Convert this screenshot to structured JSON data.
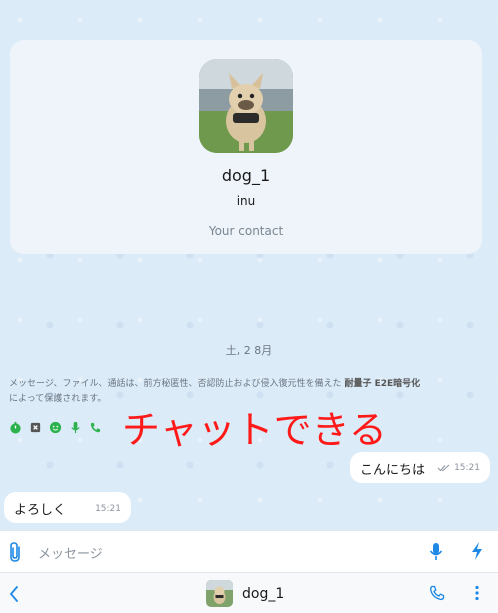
{
  "contact": {
    "name": "dog_1",
    "subtitle": "inu",
    "note": "Your contact"
  },
  "chat": {
    "date_separator": "土, 2 8月",
    "e2e_notice_prefix": "メッセージ、ファイル、通話は、前方秘匿性、否認防止および侵入復元性を備えた",
    "e2e_notice_bold": "耐量子 E2E暗号化",
    "e2e_notice_suffix": "によって保護されます。",
    "overlay_caption": "チャットできる",
    "messages": [
      {
        "direction": "outgoing",
        "text": "こんにちは",
        "time": "15:21"
      },
      {
        "direction": "incoming",
        "text": "よろしく",
        "time": "15:21"
      }
    ]
  },
  "composer": {
    "placeholder": "メッセージ"
  },
  "footer": {
    "contact_name": "dog_1"
  },
  "colors": {
    "accent": "#1e88e5",
    "overlay": "#ff1a1a",
    "e2e_green": "#2bb24c"
  },
  "icons": [
    "paperclip-icon",
    "mic-icon",
    "bolt-icon",
    "back-icon",
    "phone-icon",
    "more-icon"
  ]
}
